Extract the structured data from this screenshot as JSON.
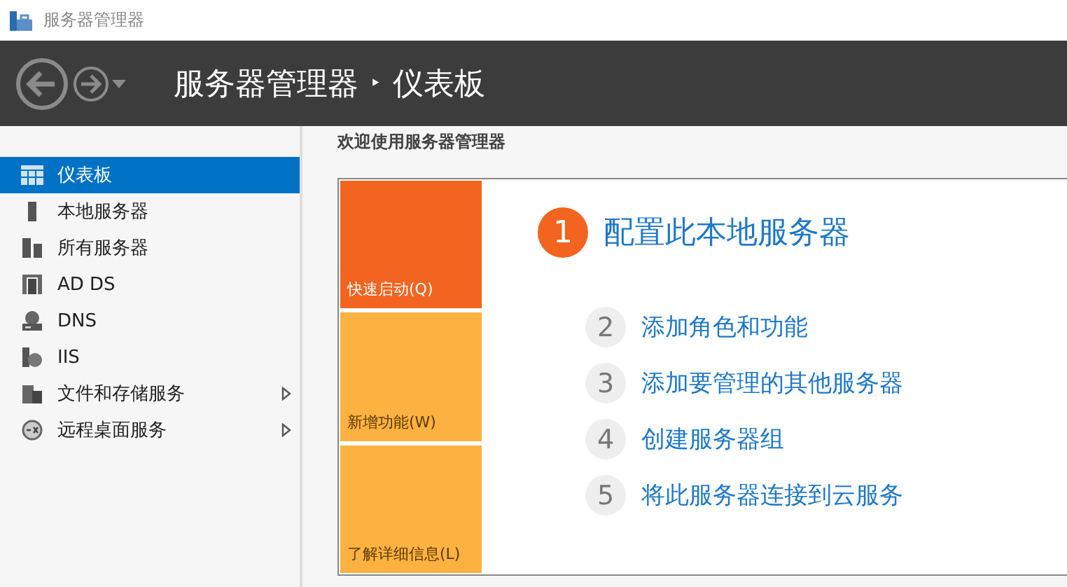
{
  "window": {
    "title": "服务器管理器"
  },
  "header": {
    "breadcrumb": "服务器管理器",
    "separator": "‣",
    "page": "仪表板"
  },
  "sidebar": {
    "items": [
      {
        "label": "仪表板",
        "selected": true,
        "has_submenu": false
      },
      {
        "label": "本地服务器",
        "selected": false,
        "has_submenu": false
      },
      {
        "label": "所有服务器",
        "selected": false,
        "has_submenu": false
      },
      {
        "label": "AD DS",
        "selected": false,
        "has_submenu": false
      },
      {
        "label": "DNS",
        "selected": false,
        "has_submenu": false
      },
      {
        "label": "IIS",
        "selected": false,
        "has_submenu": false
      },
      {
        "label": "文件和存储服务",
        "selected": false,
        "has_submenu": true
      },
      {
        "label": "远程桌面服务",
        "selected": false,
        "has_submenu": true
      }
    ]
  },
  "welcome": {
    "title": "欢迎使用服务器管理器",
    "tiles": [
      {
        "label": "快速启动(Q)",
        "selected": true
      },
      {
        "label": "新增功能(W)",
        "selected": false
      },
      {
        "label": "了解详细信息(L)",
        "selected": false
      }
    ],
    "steps": [
      {
        "number": "1",
        "label": "配置此本地服务器",
        "selected": true
      },
      {
        "number": "2",
        "label": "添加角色和功能",
        "selected": false
      },
      {
        "number": "3",
        "label": "添加要管理的其他服务器",
        "selected": false
      },
      {
        "number": "4",
        "label": "创建服务器组",
        "selected": false
      },
      {
        "number": "5",
        "label": "将此服务器连接到云服务",
        "selected": false
      }
    ]
  }
}
